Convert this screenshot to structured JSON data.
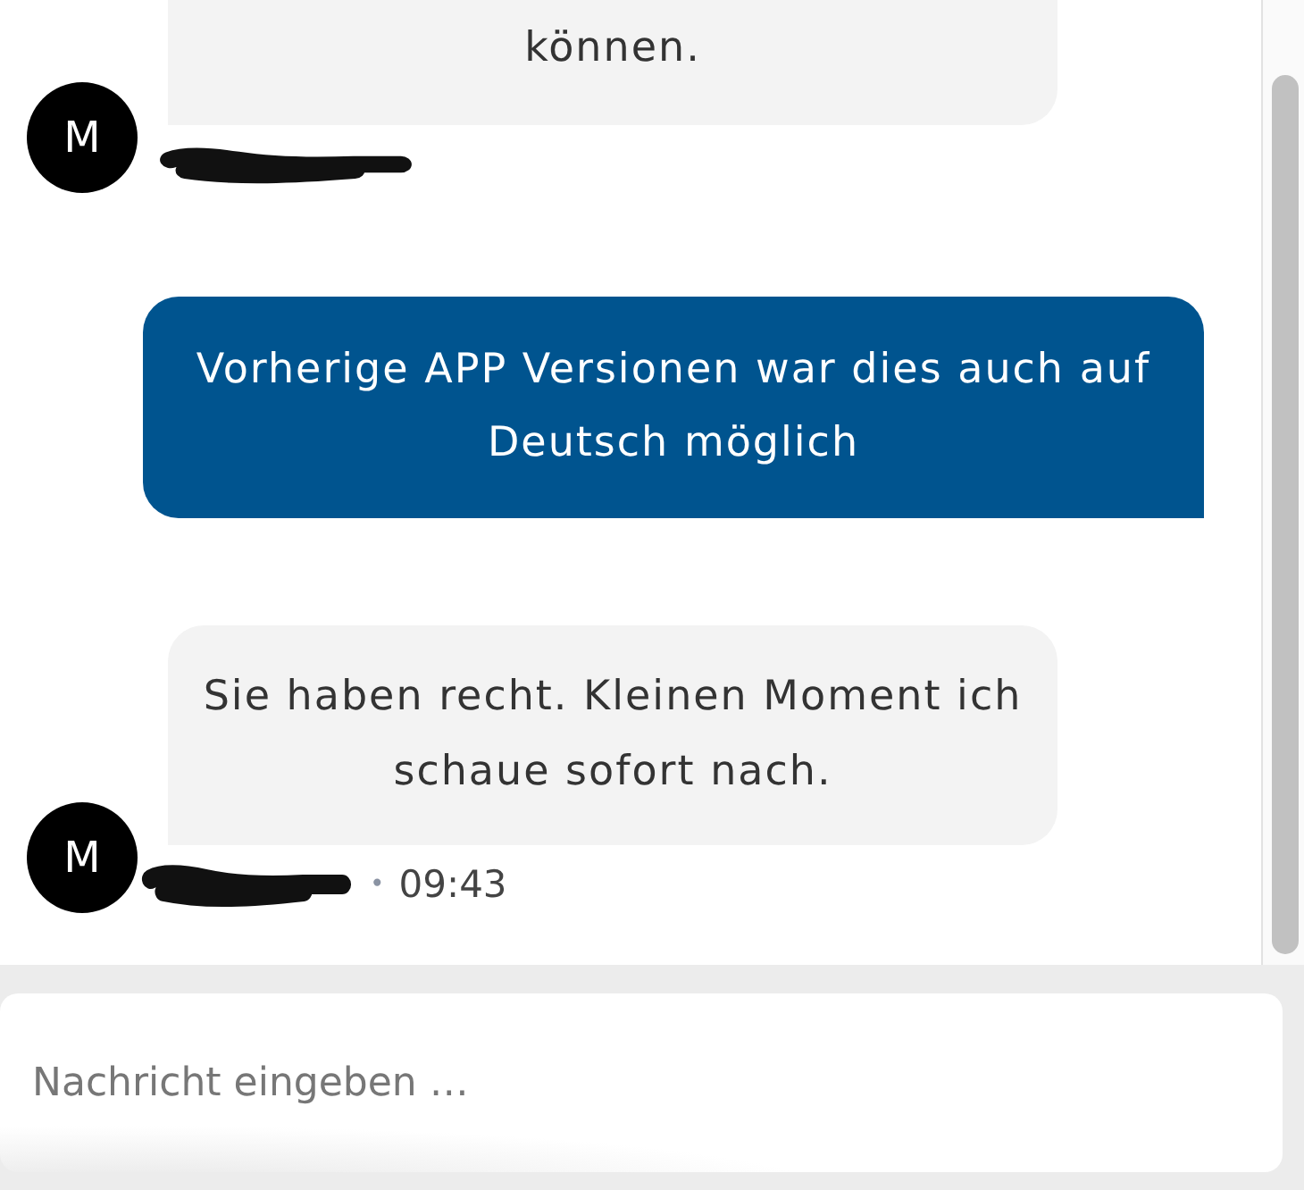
{
  "conversation": {
    "messages": [
      {
        "kind": "incoming",
        "text": "können.",
        "avatar": "M",
        "sender_redacted": true
      },
      {
        "kind": "outgoing",
        "text": "Vorherige APP Versionen war dies auch auf Deutsch möglich"
      },
      {
        "kind": "incoming",
        "text": "Sie haben recht. Kleinen Moment ich schaue sofort nach.",
        "avatar": "M",
        "sender_redacted": true,
        "separator": "•",
        "time": "09:43"
      }
    ]
  },
  "composer": {
    "placeholder": "Nachricht eingeben …"
  }
}
